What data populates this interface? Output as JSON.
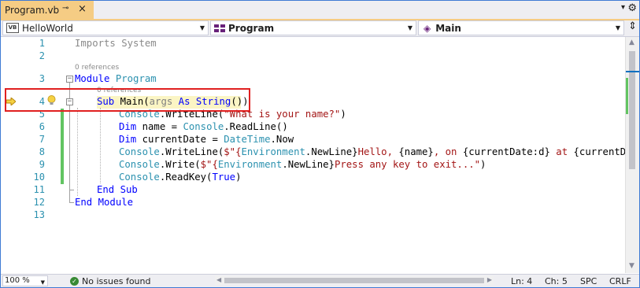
{
  "tab": {
    "title": "Program.vb",
    "pin_glyph": "⊸",
    "close_glyph": "×",
    "overflow_glyph": "▾",
    "settings_glyph": "⚙"
  },
  "navbar": {
    "project": "HelloWorld",
    "project_badge": "VB",
    "type": "Program",
    "member": "Main",
    "dropdown_glyph": "▼",
    "split_glyph": "⇕"
  },
  "editor": {
    "line_numbers": [
      "1",
      "2",
      "3",
      "4",
      "5",
      "6",
      "7",
      "8",
      "9",
      "10",
      "11",
      "12",
      "13"
    ],
    "lens": {
      "module_refs": "0 references",
      "sub_refs": "0 references"
    },
    "collapse_glyph": "−",
    "lines": {
      "l1": {
        "kw": "Imports",
        "rest": " System"
      },
      "l3": {
        "kw": "Module",
        "rest": " Program"
      },
      "l4": {
        "kw1": "Sub",
        "name": " Main(",
        "param": "args",
        "kw2": " As String",
        "close": "())"
      },
      "l5": {
        "obj": "Console",
        "call": ".WriteLine(",
        "str": "\"What is your name?\"",
        "close": ")"
      },
      "l6": {
        "kw": "Dim",
        "mid": " name = ",
        "obj": "Console",
        "call": ".ReadLine()"
      },
      "l7": {
        "kw": "Dim",
        "mid": " currentDate = ",
        "obj": "DateTime",
        "call": ".Now"
      },
      "l8": {
        "obj": "Console",
        "call": ".WriteLine(",
        "s1": "$\"{",
        "env": "Environment",
        "nl": ".NewLine}",
        "s2": "Hello, ",
        "b1": "{name}",
        "s3": ", on ",
        "b2": "{currentDate:d}",
        "s4": " at ",
        "b3": "{currentDate:t"
      },
      "l9": {
        "obj": "Console",
        "call": ".Write(",
        "s1": "$\"{",
        "env": "Environment",
        "nl": ".NewLine}",
        "s2": "Press any key to exit...\"",
        "close": ")"
      },
      "l10": {
        "obj": "Console",
        "call": ".ReadKey(",
        "kw": "True",
        "close": ")"
      },
      "l11": {
        "kw": "End Sub"
      },
      "l12": {
        "kw": "End Module"
      }
    }
  },
  "scroll": {
    "up_glyph": "▲",
    "down_glyph": "▼",
    "left_glyph": "◀",
    "right_glyph": "▶"
  },
  "status": {
    "zoom": "100 %",
    "zoom_arrow": "▼",
    "issues": "No issues found",
    "ok_glyph": "✓",
    "line": "Ln: 4",
    "col": "Ch: 5",
    "indent": "SPC",
    "eol": "CRLF"
  },
  "colors": {
    "tab_active": "#f5cc84",
    "change_bar": "#62c462",
    "highlight": "#fbf5c4",
    "callout": "#e02020"
  }
}
